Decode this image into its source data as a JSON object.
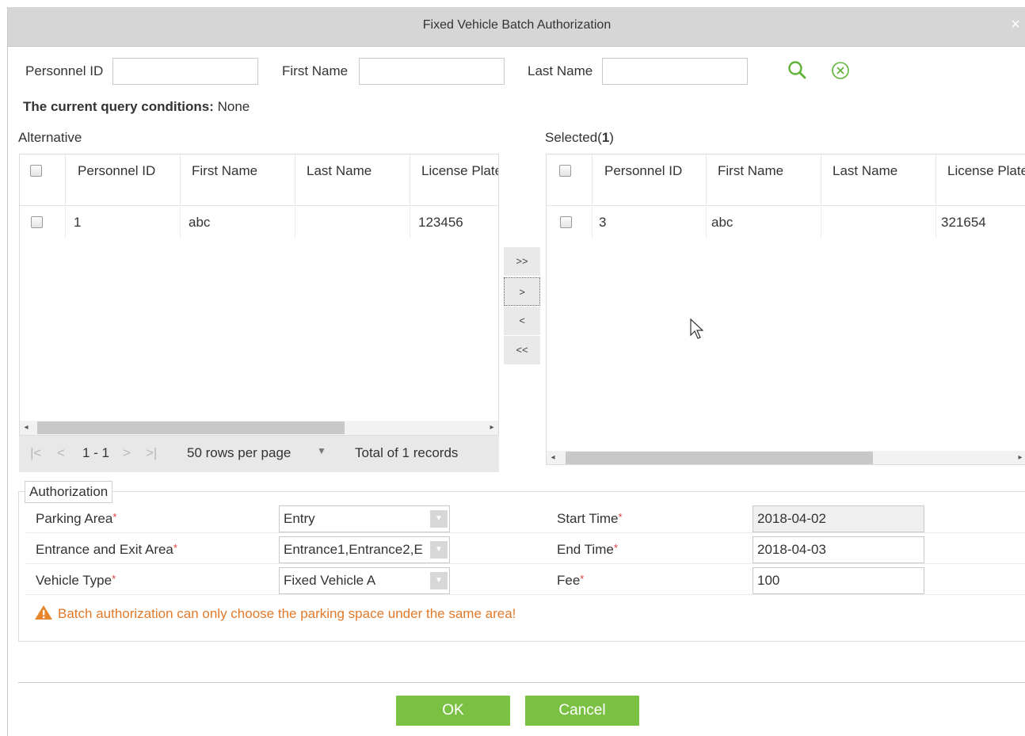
{
  "dialog": {
    "title": "Fixed Vehicle Batch Authorization",
    "close_glyph": "×"
  },
  "filters": {
    "personnel_id_label": "Personnel ID",
    "personnel_id_value": "",
    "first_name_label": "First Name",
    "first_name_value": "",
    "last_name_label": "Last Name",
    "last_name_value": ""
  },
  "query": {
    "label": "The current query conditions:",
    "value": "None"
  },
  "alternative": {
    "title": "Alternative",
    "columns": [
      "Personnel ID",
      "First Name",
      "Last Name",
      "License Plate"
    ],
    "rows": [
      {
        "id": "1",
        "first": "abc",
        "last": "",
        "plate": "123456"
      }
    ],
    "pager": {
      "range": "1 - 1",
      "rows_per_page": "50 rows per page",
      "total": "Total of 1 records",
      "first_icon": "|<",
      "prev_icon": "<",
      "next_icon": ">",
      "last_icon": ">|"
    }
  },
  "selected": {
    "title_prefix": "Selected(",
    "count": "1",
    "title_suffix": ")",
    "columns": [
      "Personnel ID",
      "First Name",
      "Last Name",
      "License Plate"
    ],
    "rows": [
      {
        "id": "3",
        "first": "abc",
        "last": "",
        "plate": "321654"
      }
    ]
  },
  "move_buttons": {
    "all_right": ">>",
    "right": ">",
    "left": "<",
    "all_left": "<<"
  },
  "authorization": {
    "legend": "Authorization",
    "parking_area_label": "Parking Area",
    "parking_area_value": "Entry",
    "entrance_exit_label": "Entrance and Exit Area",
    "entrance_exit_value": "Entrance1,Entrance2,E",
    "vehicle_type_label": "Vehicle Type",
    "vehicle_type_value": "Fixed Vehicle A",
    "start_time_label": "Start Time",
    "start_time_value": "2018-04-02",
    "end_time_label": "End Time",
    "end_time_value": "2018-04-03",
    "fee_label": "Fee",
    "fee_value": "100",
    "required_mark": "*",
    "warning": "Batch authorization can only choose the parking space under the same area!"
  },
  "footer": {
    "ok_label": "OK",
    "cancel_label": "Cancel"
  },
  "colors": {
    "accent": "#7ac143",
    "warning": "#e07a2b",
    "required": "#e03b3b",
    "titlebar": "#d6d6d6"
  },
  "icons": {
    "search": "search-icon",
    "clear": "clear-circle-icon",
    "warning": "warning-icon",
    "dropdown": "dropdown-arrow-icon"
  }
}
